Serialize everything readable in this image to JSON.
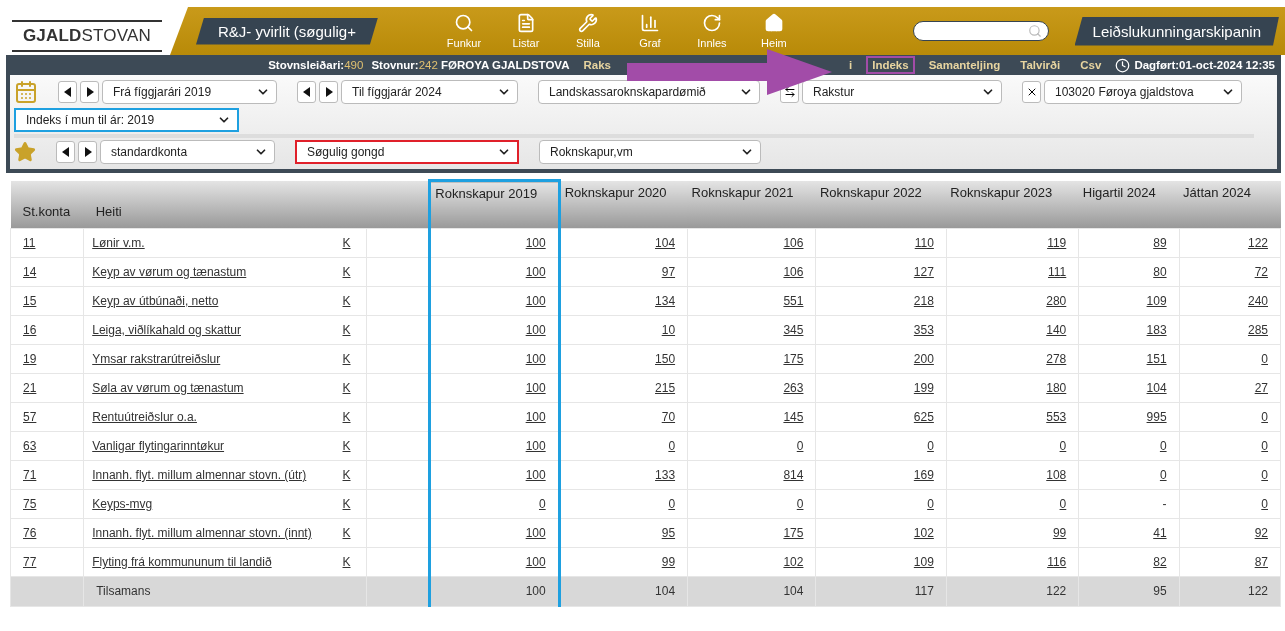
{
  "header": {
    "logo": "**GJALD**STOVAN",
    "page_title": "R&J- yvirlit (søgulig+",
    "tools": [
      {
        "kind": "search",
        "label": "Funkur"
      },
      {
        "kind": "list",
        "label": "Listar"
      },
      {
        "kind": "tools",
        "label": "Stilla"
      },
      {
        "kind": "chart",
        "label": "Graf"
      },
      {
        "kind": "reload",
        "label": "Innles"
      },
      {
        "kind": "home",
        "label": "Heim"
      }
    ],
    "org_button": "Leiðslukunningarskipanin"
  },
  "info_bar": {
    "stats": [
      {
        "label": "Stovnsleiðari:",
        "value": "490"
      },
      {
        "label": "Stovnur:",
        "value": "242",
        "name": "FØROYA GJALDSTOVA"
      }
    ],
    "links": [
      {
        "kind": "link",
        "label": "Raks",
        "selected": false
      },
      {
        "kind": "arrow",
        "color": "#a24ca8"
      },
      {
        "kind": "link",
        "label": "i",
        "selected": false
      },
      {
        "kind": "link",
        "label": "Indeks",
        "selected": true
      },
      {
        "kind": "link",
        "label": "Samanteljing",
        "selected": false
      },
      {
        "kind": "link",
        "label": "Talvirði",
        "selected": false
      },
      {
        "kind": "link",
        "label": "Csv",
        "selected": false
      }
    ],
    "updated": "Dagført:01-oct-2024 12:35"
  },
  "filters": {
    "rows": [
      {
        "items": [
          {
            "kind": "nav-select",
            "value": "Frá fíggjarári 2019"
          },
          {
            "kind": "nav-select",
            "value": "Til fíggjarár 2024"
          },
          {
            "kind": "select",
            "value": "Landskassaroknskapardømið"
          },
          {
            "kind": "swap-select",
            "value": "Rakstur"
          },
          {
            "kind": "clear-select",
            "value": "103020 Føroya gjaldstova"
          },
          {
            "kind": "select",
            "value": "Indeks í mun til ár: 2019",
            "color": "#1ea0e0"
          }
        ]
      },
      {
        "items": [
          {
            "kind": "nav-select",
            "value": "standardkonta"
          },
          {
            "kind": "select",
            "value": "Søgulig gongd",
            "color": "#e0202a"
          },
          {
            "kind": "select",
            "value": "Roknskapur,vm"
          }
        ]
      }
    ]
  },
  "table": {
    "columns": [
      {
        "label": "St.konta"
      },
      {
        "label": "Heiti"
      },
      {},
      {
        "label": "Roknskapur 2019",
        "color": "#1ea0e0"
      },
      {
        "label": "Roknskapur 2020"
      },
      {
        "label": "Roknskapur 2021"
      },
      {
        "label": "Roknskapur 2022"
      },
      {
        "label": "Roknskapur 2023"
      },
      {
        "label": "Higartil 2024"
      },
      {
        "label": "Játtan 2024"
      }
    ],
    "rows": [
      {
        "code": "11",
        "name": "Lønir v.m.",
        "link": "K",
        "values": [
          "100",
          "104",
          "106",
          "110",
          "119",
          "89",
          "122"
        ]
      },
      {
        "code": "14",
        "name": "Keyp av vørum og tænastum",
        "link": "K",
        "values": [
          "100",
          "97",
          "106",
          "127",
          "111",
          "80",
          "72"
        ]
      },
      {
        "code": "15",
        "name": "Keyp av útbúnaði, netto",
        "link": "K",
        "values": [
          "100",
          "134",
          "551",
          "218",
          "280",
          "109",
          "240"
        ]
      },
      {
        "code": "16",
        "name": "Leiga, viðlíkahald og skattur",
        "link": "K",
        "values": [
          "100",
          "10",
          "345",
          "353",
          "140",
          "183",
          "285"
        ]
      },
      {
        "code": "19",
        "name": "Ymsar rakstrarútreiðslur",
        "link": "K",
        "values": [
          "100",
          "150",
          "175",
          "200",
          "278",
          "151",
          "0"
        ]
      },
      {
        "code": "21",
        "name": "Søla av vørum og tænastum",
        "link": "K",
        "values": [
          "100",
          "215",
          "263",
          "199",
          "180",
          "104",
          "27"
        ]
      },
      {
        "code": "57",
        "name": "Rentuútreiðslur o.a.",
        "link": "K",
        "values": [
          "100",
          "70",
          "145",
          "625",
          "553",
          "995",
          "0"
        ]
      },
      {
        "code": "63",
        "name": "Vanligar flytingarinntøkur",
        "link": "K",
        "values": [
          "100",
          "0",
          "0",
          "0",
          "0",
          "0",
          "0"
        ]
      },
      {
        "code": "71",
        "name": "Innanh. flyt. millum almennar stovn. (útr)",
        "link": "K",
        "values": [
          "100",
          "133",
          "814",
          "169",
          "108",
          "0",
          "0"
        ]
      },
      {
        "code": "75",
        "name": "Keyps-mvg",
        "link": "K",
        "values": [
          "0",
          "0",
          "0",
          "0",
          "0",
          "-",
          "0"
        ]
      },
      {
        "code": "76",
        "name": "Innanh. flyt. millum almennar stovn. (innt)",
        "link": "K",
        "values": [
          "100",
          "95",
          "175",
          "102",
          "99",
          "41",
          "92"
        ]
      },
      {
        "code": "77",
        "name": "Flyting frá kommununum til landið",
        "link": "K",
        "values": [
          "100",
          "99",
          "102",
          "109",
          "116",
          "82",
          "87"
        ]
      }
    ],
    "total": {
      "label": "Tilsamans",
      "values": [
        "100",
        "104",
        "104",
        "117",
        "122",
        "95",
        "122"
      ]
    }
  }
}
